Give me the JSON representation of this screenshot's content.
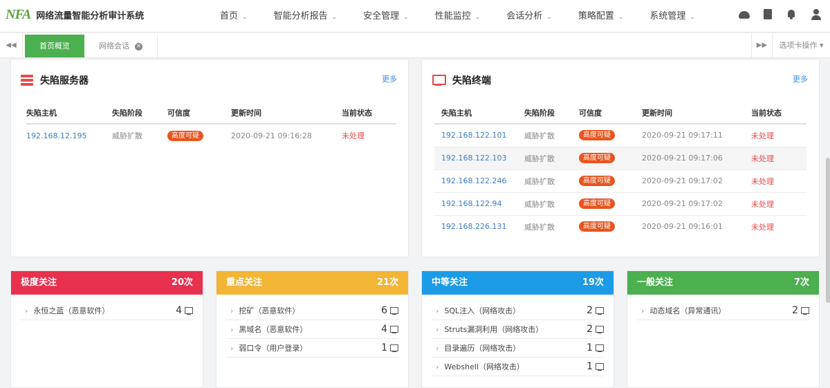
{
  "app": {
    "logo": "NFA",
    "title": "网络流量智能分析审计系统"
  },
  "nav": [
    {
      "label": "首页"
    },
    {
      "label": "智能分析报告"
    },
    {
      "label": "安全管理"
    },
    {
      "label": "性能监控"
    },
    {
      "label": "会话分析"
    },
    {
      "label": "策略配置"
    },
    {
      "label": "系统管理"
    }
  ],
  "tabs": {
    "active": "首页概览",
    "second": "网络会话",
    "ops": "选项卡操作 ▾"
  },
  "servers": {
    "title": "失陷服务器",
    "more": "更多",
    "columns": [
      "失陷主机",
      "失陷阶段",
      "可信度",
      "更新时间",
      "当前状态"
    ],
    "rows": [
      {
        "host": "192.168.12.195",
        "stage": "威胁扩散",
        "credibility": "高度可疑",
        "time": "2020-09-21 09:16:28",
        "status": "未处理"
      }
    ]
  },
  "terminals": {
    "title": "失陷终端",
    "more": "更多",
    "columns": [
      "失陷主机",
      "失陷阶段",
      "可信度",
      "更新时间",
      "当前状态"
    ],
    "rows": [
      {
        "host": "192.168.122.101",
        "stage": "威胁扩散",
        "credibility": "高度可疑",
        "time": "2020-09-21 09:17:11",
        "status": "未处理"
      },
      {
        "host": "192.168.122.103",
        "stage": "威胁扩散",
        "credibility": "高度可疑",
        "time": "2020-09-21 09:17:06",
        "status": "未处理"
      },
      {
        "host": "192.168.122.246",
        "stage": "威胁扩散",
        "credibility": "高度可疑",
        "time": "2020-09-21 09:17:02",
        "status": "未处理"
      },
      {
        "host": "192.168.122.94",
        "stage": "威胁扩散",
        "credibility": "高度可疑",
        "time": "2020-09-21 09:17:02",
        "status": "未处理"
      },
      {
        "host": "192.168.226.131",
        "stage": "威胁扩散",
        "credibility": "高度可疑",
        "time": "2020-09-21 09:16:01",
        "status": "未处理"
      }
    ]
  },
  "levels": [
    {
      "title": "极度关注",
      "count": "20次",
      "color": "#e8304f",
      "items": [
        {
          "label": "永恒之蓝（恶意软件）",
          "count": "4"
        }
      ]
    },
    {
      "title": "重点关注",
      "count": "21次",
      "color": "#f2b536",
      "items": [
        {
          "label": "挖矿（恶意软件）",
          "count": "6"
        },
        {
          "label": "黑域名（恶意软件）",
          "count": "4"
        },
        {
          "label": "弱口令（用户登录）",
          "count": "1"
        }
      ]
    },
    {
      "title": "中等关注",
      "count": "19次",
      "color": "#1c9be6",
      "items": [
        {
          "label": "SQL注入（网络攻击）",
          "count": "2"
        },
        {
          "label": "Struts漏洞利用（网络攻击）",
          "count": "2"
        },
        {
          "label": "目录遍历（网络攻击）",
          "count": "1"
        },
        {
          "label": "Webshell（网络攻击）",
          "count": "1"
        }
      ]
    },
    {
      "title": "一般关注",
      "count": "7次",
      "color": "#4caf50",
      "items": [
        {
          "label": "动态域名（异常通讯）",
          "count": "2"
        }
      ]
    }
  ]
}
